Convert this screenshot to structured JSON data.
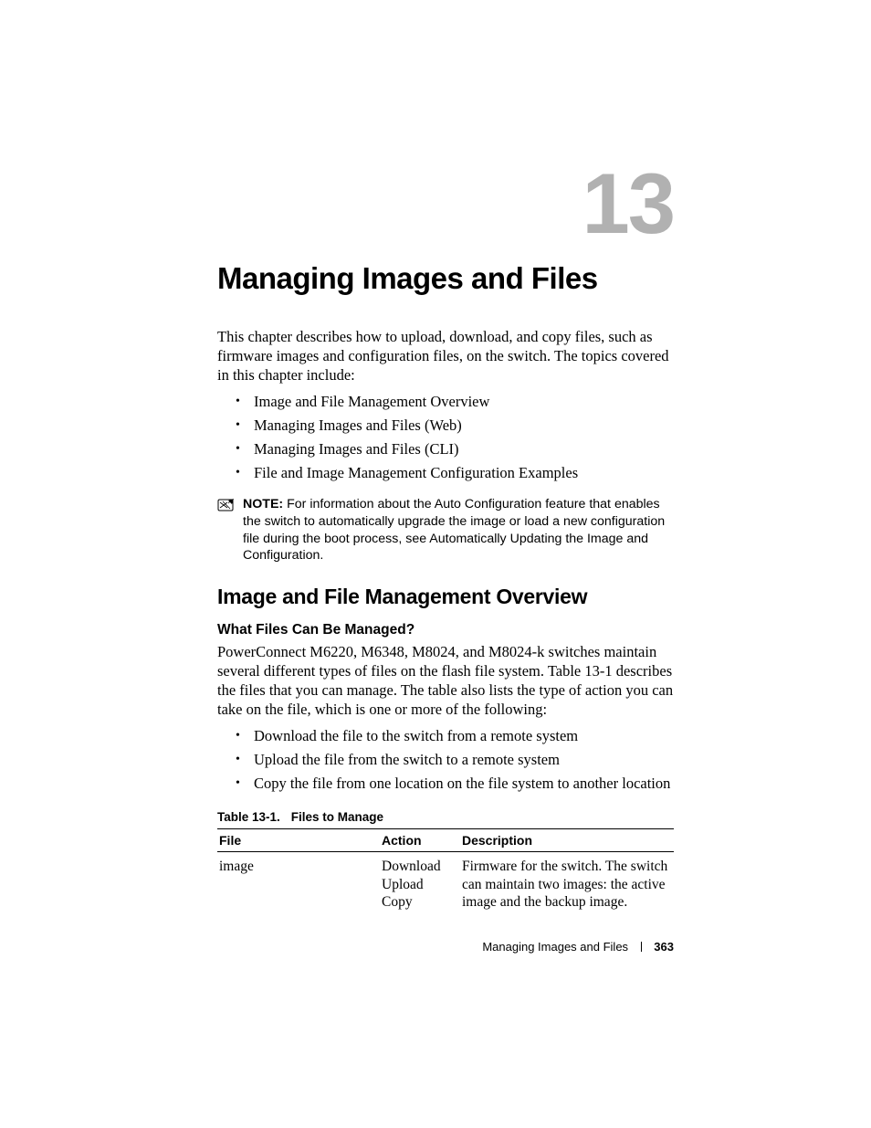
{
  "chapter_number": "13",
  "title": "Managing Images and Files",
  "intro": "This chapter describes how to upload, download, and copy files, such as firmware images and configuration files, on the switch. The topics covered in this chapter include:",
  "topics": [
    "Image and File Management Overview",
    "Managing Images and Files (Web)",
    "Managing Images and Files (CLI)",
    "File and Image Management Configuration Examples"
  ],
  "note_label": "NOTE:",
  "note_text": "For information about the Auto Configuration feature that enables the switch to automatically upgrade the image or load a new configuration file during the boot process, see Automatically Updating the Image and Configuration.",
  "section_heading": "Image and File Management Overview",
  "subsection_heading": "What Files Can Be Managed?",
  "overview_p1": "PowerConnect M6220, M6348, M8024, and M8024-k switches maintain several different types of files on the flash file system. Table 13-1 describes the files that you can manage. The table also lists the type of action you can take on the file, which is one or more of the following:",
  "actions_list": [
    "Download the file to the switch from a remote system",
    "Upload the file from the switch to a remote system",
    "Copy the file from one location on the file system to another location"
  ],
  "table_caption_label": "Table 13-1.",
  "table_caption_title": "Files to Manage",
  "table_headers": {
    "file": "File",
    "action": "Action",
    "description": "Description"
  },
  "table_rows": [
    {
      "file": "image",
      "action": "Download\nUpload\nCopy",
      "description": "Firmware for the switch. The switch can maintain two images: the active image and the backup image."
    }
  ],
  "footer_title": "Managing Images and Files",
  "page_number": "363"
}
